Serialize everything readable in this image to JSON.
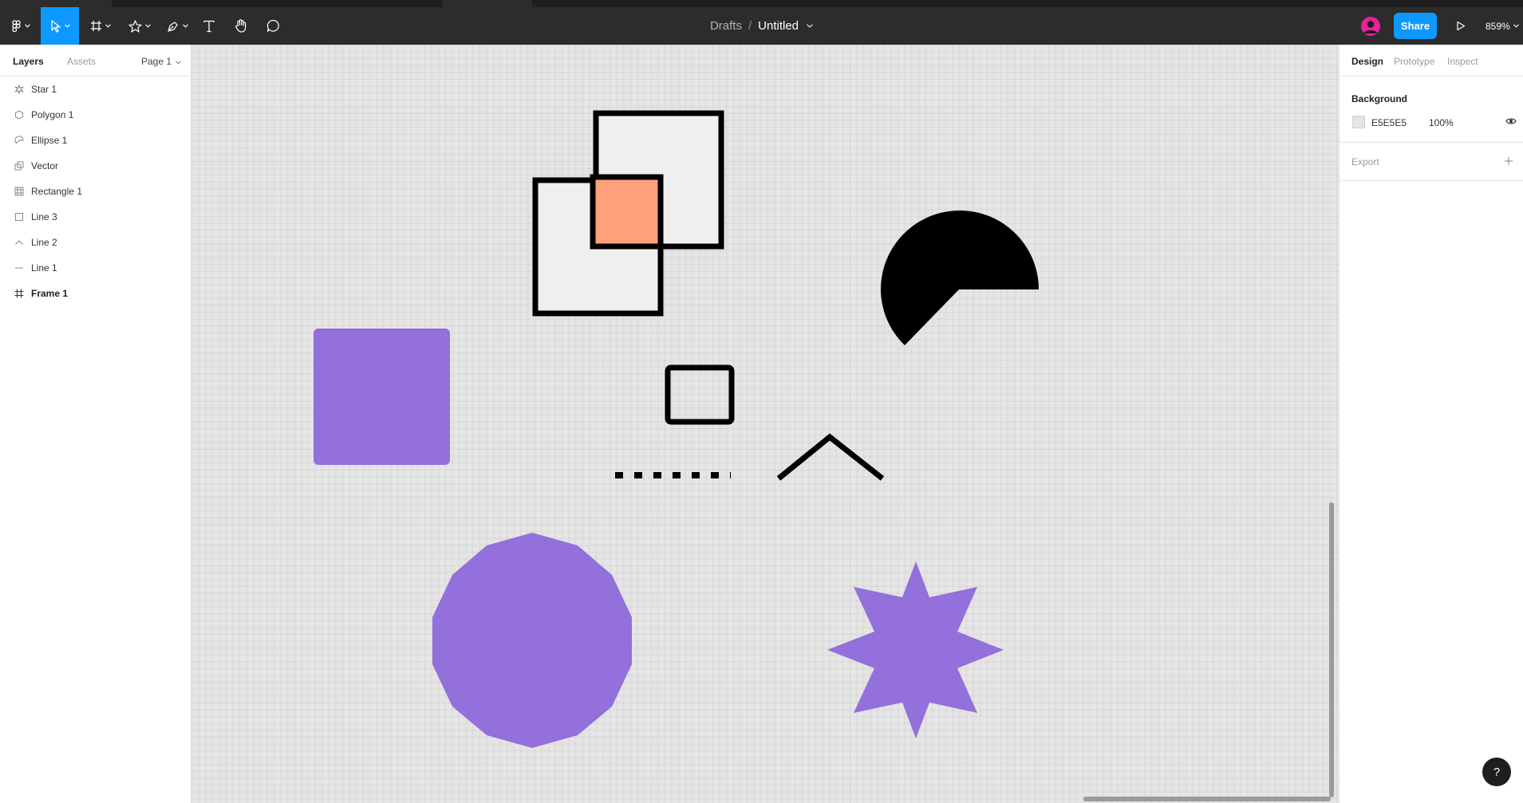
{
  "toolbar": {
    "breadcrumb_root": "Drafts",
    "breadcrumb_separator": "/",
    "file_title": "Untitled",
    "share_label": "Share",
    "zoom_level": "859%",
    "icons": [
      "figma-menu-icon",
      "move-tool-icon",
      "frame-tool-icon",
      "shape-tool-icon",
      "pen-tool-icon",
      "text-tool-icon",
      "hand-tool-icon",
      "comment-tool-icon",
      "play-icon"
    ],
    "accent_color": "#0d99ff",
    "avatar_color": "#e7209c"
  },
  "left_panel": {
    "tabs": [
      {
        "label": "Layers",
        "active": true
      },
      {
        "label": "Assets",
        "active": false
      }
    ],
    "page_selector": "Page 1",
    "layers": [
      {
        "label": "Star 1",
        "icon": "star-icon"
      },
      {
        "label": "Polygon 1",
        "icon": "polygon-icon"
      },
      {
        "label": "Ellipse 1",
        "icon": "ellipse-icon"
      },
      {
        "label": "Vector",
        "icon": "vector-icon"
      },
      {
        "label": "Rectangle 1",
        "icon": "rectangle-icon"
      },
      {
        "label": "Line 3",
        "icon": "line-icon"
      },
      {
        "label": "Line 2",
        "icon": "line-icon"
      },
      {
        "label": "Line 1",
        "icon": "line-icon"
      },
      {
        "label": "Frame 1",
        "icon": "frame-icon"
      }
    ]
  },
  "right_panel": {
    "tabs": [
      {
        "label": "Design",
        "active": true
      },
      {
        "label": "Prototype",
        "active": false
      },
      {
        "label": "Inspect",
        "active": false
      }
    ],
    "background": {
      "title": "Background",
      "hex": "E5E5E5",
      "opacity": "100%",
      "visibility_icon": "eye-icon"
    },
    "export": {
      "title": "Export",
      "add_icon": "plus-icon"
    }
  },
  "canvas": {
    "background_color": "#e5e5e5",
    "shape_fill_purple": "#9370db",
    "shape_fill_orange": "#ffa07a",
    "stroke_color": "#000000"
  },
  "help_label": "?"
}
